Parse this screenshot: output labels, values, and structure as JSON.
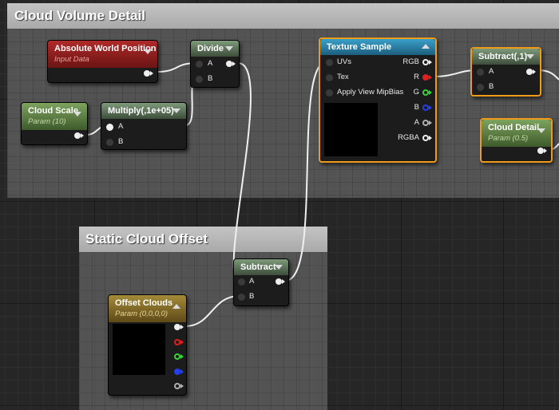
{
  "comments": {
    "cloud_volume": {
      "title": "Cloud Volume Detail"
    },
    "static_offset": {
      "title": "Static Cloud Offset"
    }
  },
  "nodes": {
    "abs_world": {
      "title": "Absolute World Position",
      "subtitle": "Input Data"
    },
    "cloud_scale": {
      "title": "Cloud Scale",
      "subtitle": "Param (10)"
    },
    "multiply": {
      "title": "Multiply(,1e+05)",
      "pin_a": "A",
      "pin_b": "B"
    },
    "divide": {
      "title": "Divide",
      "pin_a": "A",
      "pin_b": "B"
    },
    "texture": {
      "title": "Texture Sample",
      "inputs": [
        "UVs",
        "Tex",
        "Apply View MipBias"
      ],
      "outputs": [
        "RGB",
        "R",
        "G",
        "B",
        "A",
        "RGBA"
      ]
    },
    "subtract1": {
      "title": "Subtract(,1)",
      "pin_a": "A",
      "pin_b": "B"
    },
    "cloud_detail": {
      "title": "Cloud Detail",
      "subtitle": "Param (0.5)"
    },
    "subtract": {
      "title": "Subtract",
      "pin_a": "A",
      "pin_b": "B"
    },
    "offset_clouds": {
      "title": "Offset Clouds",
      "subtitle": "Param (0,0,0,0)"
    }
  },
  "colors": {
    "accent_selected": "#f09a1a",
    "pin_red": "#e02020",
    "pin_green": "#3ad23a",
    "pin_blue": "#2540e8",
    "pin_white": "#eeeeee",
    "pin_grey": "#b0b0b0"
  }
}
